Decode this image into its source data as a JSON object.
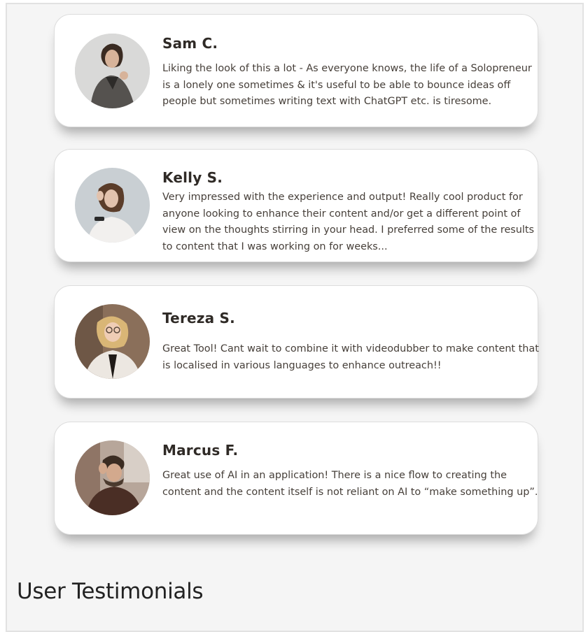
{
  "testimonials": [
    {
      "name": "Sam C.",
      "text": "Liking the look of this a lot - As everyone knows, the life of a Solopreneur is a lonely one sometimes & it's useful to be able to bounce ideas off people but sometimes writing text with ChatGPT etc. is tiresome.",
      "avatar_icon": "person-photo-icon"
    },
    {
      "name": "Kelly S.",
      "text": "Very impressed with the experience and output! Really cool product for anyone looking to enhance their content and/or get a different point of view on the thoughts stirring in your head. I preferred some of the results to content that I was working on for weeks...",
      "avatar_icon": "person-photo-icon"
    },
    {
      "name": "Tereza S.",
      "text": "Great Tool! Cant wait to combine it with videodubber to make content that is localised in various languages to enhance outreach!!",
      "avatar_icon": "person-photo-icon"
    },
    {
      "name": "Marcus F.",
      "text": "Great use of AI in an application! There is a nice flow to creating the content and the content itself is not reliant on AI to “make something up”.",
      "avatar_icon": "person-photo-icon"
    }
  ],
  "section": {
    "title": "User Testimonials"
  },
  "colors": {
    "background": "#f5f5f5",
    "card": "#ffffff",
    "name_text": "#2f2a26",
    "body_text": "#463f39"
  }
}
